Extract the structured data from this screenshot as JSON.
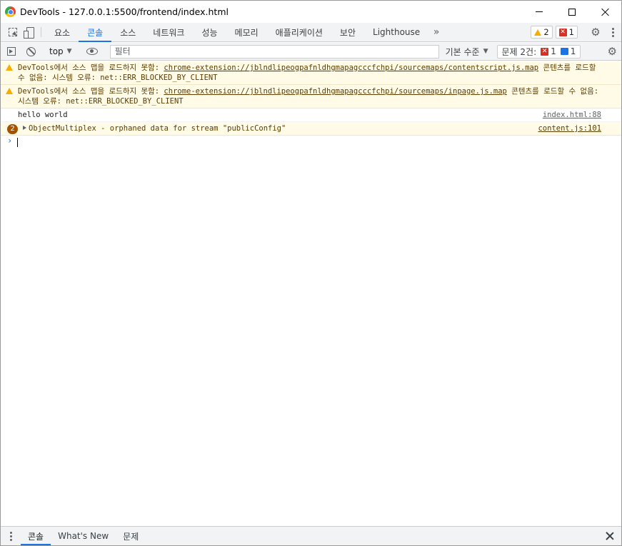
{
  "window": {
    "title": "DevTools - 127.0.0.1:5500/frontend/index.html"
  },
  "tabs": [
    {
      "label": "요소"
    },
    {
      "label": "콘솔",
      "active": true
    },
    {
      "label": "소스"
    },
    {
      "label": "네트워크"
    },
    {
      "label": "성능"
    },
    {
      "label": "메모리"
    },
    {
      "label": "애플리케이션"
    },
    {
      "label": "보안"
    },
    {
      "label": "Lighthouse"
    }
  ],
  "tab_badges": {
    "warnings": "2",
    "errors": "1"
  },
  "console_toolbar": {
    "context": "top",
    "filter_placeholder": "필터",
    "levels": "기본 수준",
    "issues_label": "문제 2건:",
    "issues_errors": "1",
    "issues_info": "1"
  },
  "messages": [
    {
      "type": "warning",
      "prefix": "DevTools에서 소스 맵을 로드하지 못함: ",
      "link": "chrome-extension://jblndlipeogpafnldhgmapagcccfchpi/sourcemaps/contentscript.js.map",
      "suffix": " 콘텐츠를 로드할 수 없음: 시스템 오류: net::ERR_BLOCKED_BY_CLIENT"
    },
    {
      "type": "warning",
      "prefix": "DevTools에서 소스 맵을 로드하지 못함: ",
      "link": "chrome-extension://jblndlipeogpafnldhgmapagcccfchpi/sourcemaps/inpage.js.map",
      "suffix": " 콘텐츠를 로드할 수 없음: 시스템 오류: net::ERR_BLOCKED_BY_CLIENT"
    },
    {
      "type": "log",
      "text": "hello world",
      "location": "index.html:88"
    },
    {
      "type": "warning-group",
      "count": "2",
      "text": "ObjectMultiplex - orphaned data for stream \"publicConfig\"",
      "location": "content.js:101"
    }
  ],
  "drawer": {
    "tabs": [
      {
        "label": "콘솔",
        "active": true
      },
      {
        "label": "What's New"
      },
      {
        "label": "문제"
      }
    ]
  },
  "colors": {
    "accent": "#1a73e8",
    "warning_bg": "#fffbe6",
    "warning_text": "#5c3c00",
    "error": "#d93025",
    "warn_icon": "#f9ab00"
  }
}
